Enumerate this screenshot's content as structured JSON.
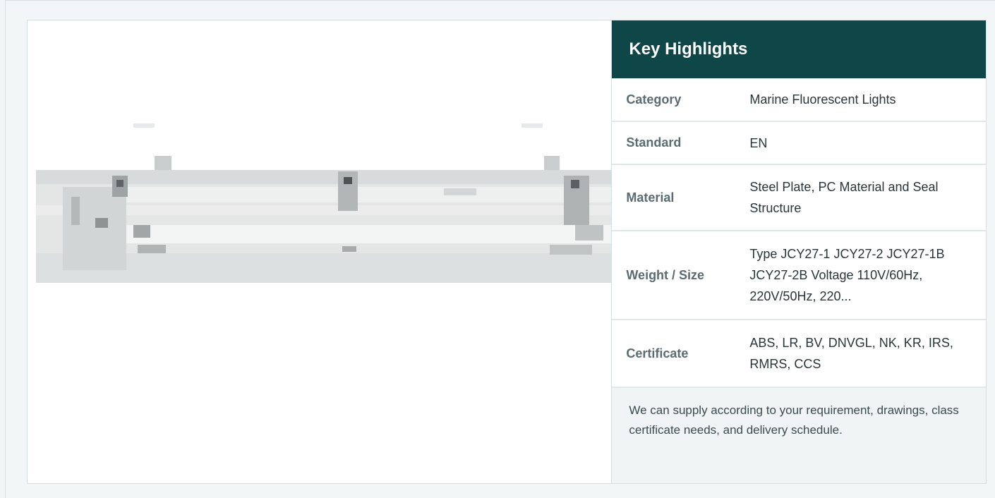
{
  "product": {
    "image_alt": "Marine fluorescent light fixture"
  },
  "highlights": {
    "title": "Key Highlights",
    "rows": [
      {
        "label": "Category",
        "value": "Marine Fluorescent Lights"
      },
      {
        "label": "Standard",
        "value": "EN"
      },
      {
        "label": "Material",
        "value": "Steel Plate, PC Material and Seal Structure"
      },
      {
        "label": "Weight / Size",
        "value": "Type JCY27-1 JCY27-2 JCY27-1B JCY27-2B Voltage 110V/60Hz, 220V/50Hz, 220..."
      },
      {
        "label": "Certificate",
        "value": "ABS, LR, BV, DNVGL, NK, KR, IRS, RMRS, CCS"
      }
    ],
    "note": "We can supply according to your requirement, drawings, class certificate needs, and delivery schedule."
  }
}
